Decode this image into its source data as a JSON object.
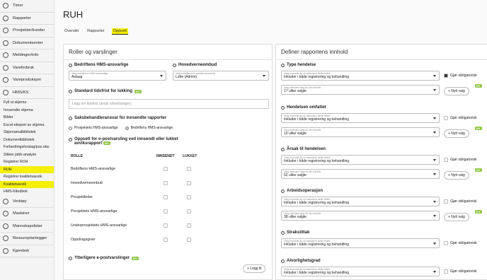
{
  "nav_top": [
    {
      "label": "Timer",
      "icon": "clock-icon"
    },
    {
      "label": "Rapporter",
      "icon": "report-icon"
    },
    {
      "label": "Prosjekter/kunder",
      "icon": "briefcase-icon"
    },
    {
      "label": "Dokumentsenter",
      "icon": "folder-icon"
    },
    {
      "label": "Meldinger/info",
      "icon": "message-icon"
    },
    {
      "label": "Vareforbruk",
      "icon": "box-icon"
    },
    {
      "label": "Vareproduksjon",
      "icon": "factory-icon"
    },
    {
      "label": "HMS/KS",
      "icon": "shield-icon"
    }
  ],
  "nav_sub": [
    "Fyll ut skjema",
    "Innsendte skjema",
    "Bilder",
    "Excel-eksport av skjema",
    "Skjemamalbibliotek",
    "Dokumentbibliotek",
    "Forbedringsforslag/pos.obs",
    "Sikker jobb-analyse",
    "Registrer RUH",
    "RUH",
    "Registrer kvalitetsavvik",
    "Kvalitetsavvik",
    "HMS-håndbok"
  ],
  "nav_bottom": [
    {
      "label": "Verktøy",
      "icon": "tool-icon"
    },
    {
      "label": "Maskiner",
      "icon": "truck-icon"
    },
    {
      "label": "Mannskapslister",
      "icon": "people-icon"
    },
    {
      "label": "Ressursplanlegger",
      "icon": "calendar-icon"
    },
    {
      "label": "Kjørebok",
      "icon": "car-icon"
    }
  ],
  "page_title": "RUH",
  "tabs": [
    "Oversikt",
    "Rapporter",
    "Oppsett"
  ],
  "left": {
    "title": "Roller og varslinger",
    "sec1": "Bedriftens HMS-ansvarlige",
    "sec2": "Hovedverneombud",
    "sel1_label": "Velg bedriftens HMS-ansvarlige",
    "sel1_value": "Aslaug",
    "sel2_label": "Velg bedriftens hovedverneombud",
    "sel2_value": "Lotte (Admin)",
    "sec3": "Standard tidsfrist for lukking",
    "new": "NY",
    "deadline_placeholder": "Legg inn tidsfrist (antall arbeidsdager)",
    "sec4": "Saksbehandleransvar for innsendte rapporter",
    "radio1": "Prosjektets HMS-ansvarlige",
    "radio2": "Bedriftens HMS-ansvarlige",
    "sec5a": "Oppsett for e-postvarsling ved innsendt eller lukket",
    "sec5b": "avviksrapport",
    "col_role": "ROLLE",
    "col_sent": "INNSENDT",
    "col_closed": "LUKKET",
    "roles": [
      "Bedriftens HMS-ansvarlige",
      "Hovedverneombud",
      "Prosjektleder",
      "Prosjektets HMS-ansvarlige",
      "Underprosjektets HMS-ansvarlige",
      "Oppdragsgiver"
    ],
    "sec6": "Ytterligere e-postvarslinger",
    "add_btn": "+ Legg til"
  },
  "right": {
    "title": "Definer rapportens innhold",
    "field_label": "Velg hvorvidt du vil inkludere dette feltet:",
    "field_value": "Inkluder i både registrering og behandling",
    "choice_label": "Velg relevant valg for din bedrift:",
    "mandatory": "Gjør obligatorisk",
    "new_choice": "+ Nytt valg",
    "new": "NY",
    "sections": [
      {
        "title": "Type hendelse",
        "choices": "17 ulike valgte",
        "checked": true
      },
      {
        "title": "Hendelsen omfattet",
        "choices": "10 ulike valgte",
        "checked": false
      },
      {
        "title": "Årsak til hendelsen",
        "choices": "52 ulike valgte",
        "checked": false
      },
      {
        "title": "Arbeidsoperasjon",
        "choices": "38 ulike valgte",
        "checked": false
      },
      {
        "title": "Strakstiltak",
        "choices": null,
        "checked": false
      },
      {
        "title": "Alvorlighetsgrad",
        "choices": null,
        "checked": false
      }
    ]
  }
}
